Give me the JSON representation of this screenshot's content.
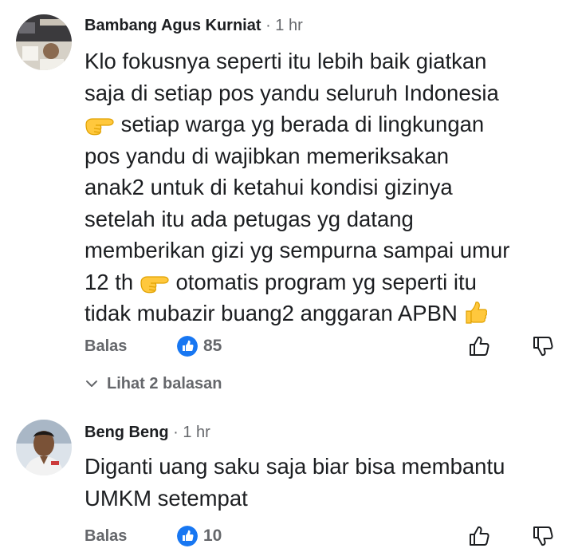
{
  "colors": {
    "text": "#1c1e21",
    "muted": "#65676b",
    "like_blue": "#1877f2",
    "emoji_yellow": "#ffc83d",
    "emoji_shade": "#e0a100"
  },
  "comments": [
    {
      "author": "Bambang Agus Kurniat",
      "time": "· 1 hr",
      "text_segments": [
        "Klo fokusnya seperti itu lebih baik giatkan\nsaja di setiap pos yandu seluruh Indonesia\n",
        " setiap warga yg berada di lingkungan\npos yandu di wajibkan memeriksakan\nanak2 untuk di ketahui kondisi gizinya\nsetelah itu ada petugas yg datang\nmemberikan gizi yg sempurna sampai umur\n12 th ",
        " otomatis program yg seperti itu\ntidak mubazir buang2 anggaran APBN "
      ],
      "emojis": [
        "backhand-index-pointing-right",
        "backhand-index-pointing-right",
        "thumbs-up"
      ],
      "reply_label": "Balas",
      "reaction_icon": "like-icon",
      "reaction_count": "85",
      "view_replies_label": "Lihat 2 balasan",
      "avatar_icon": "user-avatar"
    },
    {
      "author": "Beng Beng",
      "time": "· 1 hr",
      "text_segments": [
        "Diganti uang saku saja biar bisa membantu\nUMKM setempat"
      ],
      "reply_label": "Balas",
      "reaction_icon": "like-icon",
      "reaction_count": "10",
      "avatar_icon": "user-avatar"
    }
  ]
}
